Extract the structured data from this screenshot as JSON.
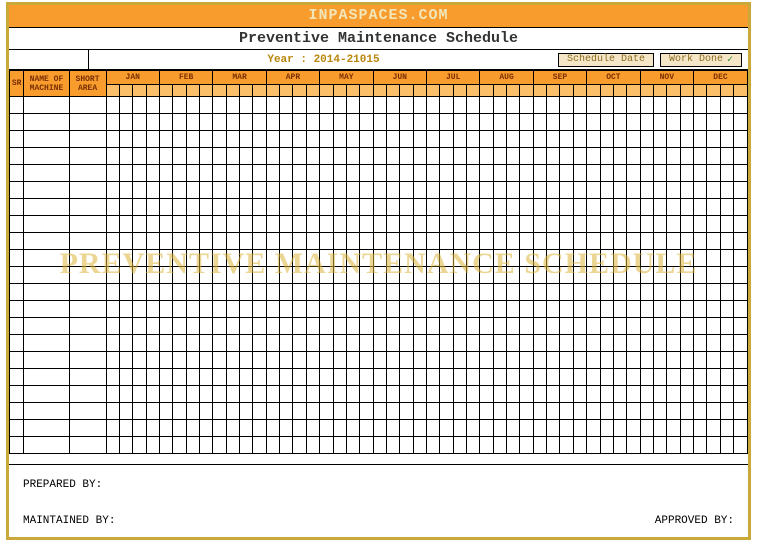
{
  "site_banner": "INPASPACES.COM",
  "title": "Preventive Maintenance Schedule",
  "year_label": "Year : 2014-21015",
  "legend": {
    "schedule_date": "Schedule Date",
    "work_done": "Work Done",
    "check": "✓"
  },
  "columns": {
    "sr": "SR",
    "name": "NAME OF MACHINE",
    "area": "SHORT AREA"
  },
  "months": [
    "JAN",
    "FEB",
    "MAR",
    "APR",
    "MAY",
    "JUN",
    "JUL",
    "AUG",
    "SEP",
    "OCT",
    "NOV",
    "DEC"
  ],
  "data_rows": 21,
  "watermark": "PREVENTIVE MAINTENANCE SCHEDULE",
  "footer": {
    "prepared_by": "PREPARED BY:",
    "maintained_by": "MAINTAINED BY:",
    "approved_by": "APPROVED BY:"
  },
  "colors": {
    "frame": "#c9a93a",
    "header_bg": "#f89c2e",
    "subheader_bg": "#fbbf6a"
  }
}
